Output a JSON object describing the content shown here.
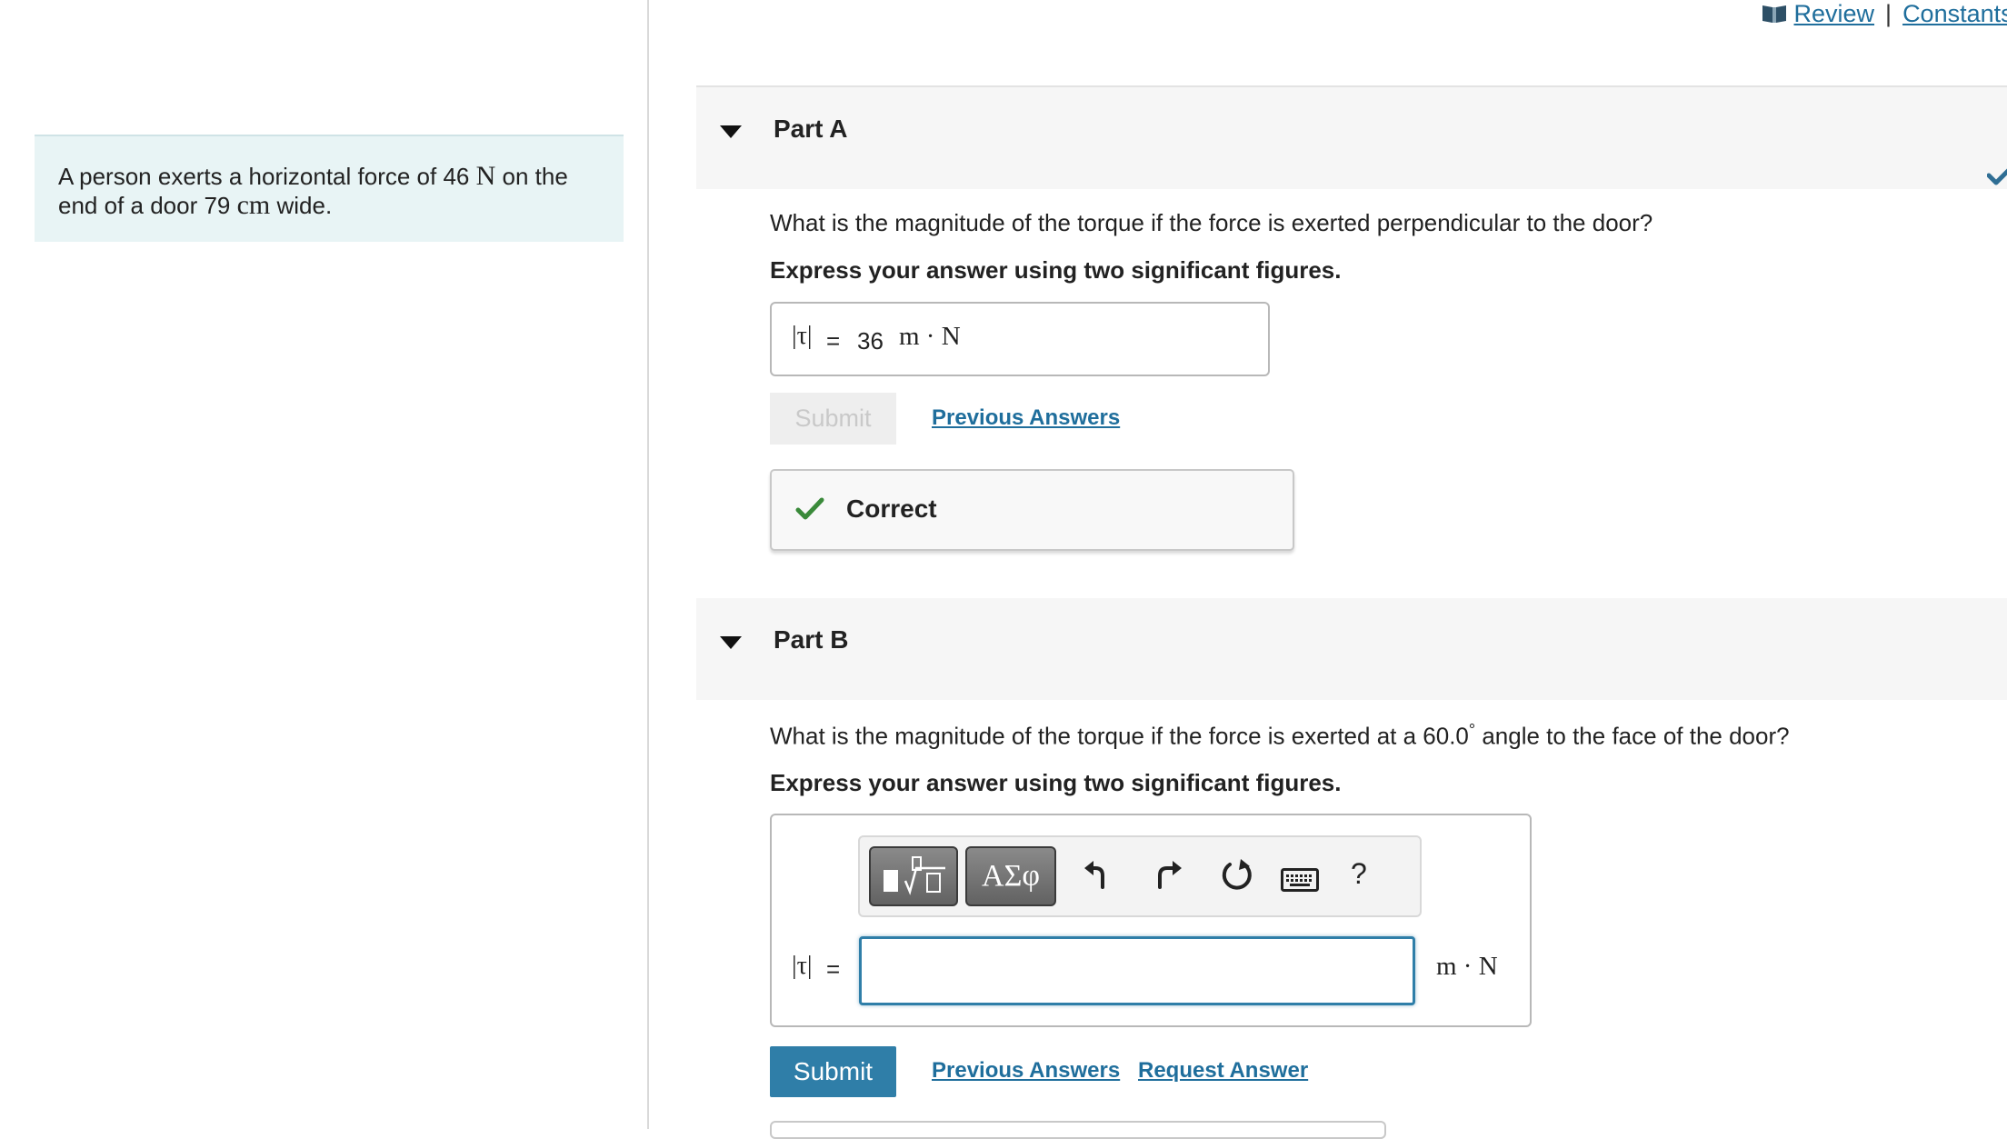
{
  "problem": {
    "text_before": "A person exerts a horizontal force of 46 ",
    "unit_force": "N",
    "text_middle": " on the end of a door 79 ",
    "unit_length": "cm",
    "text_after": " wide."
  },
  "top_links": {
    "review": "Review",
    "separator": "|",
    "constants": "Constants"
  },
  "part_a": {
    "title": "Part A",
    "question": "What is the magnitude of the torque if the force is exerted perpendicular to the door?",
    "instruction": "Express your answer using two significant figures.",
    "lhs": "|τ|",
    "equals": "=",
    "answer_value": "36",
    "unit": "m · N",
    "submit_label": "Submit",
    "previous_answers": "Previous Answers",
    "feedback": "Correct"
  },
  "part_b": {
    "title": "Part B",
    "question_before": "What is the magnitude of the torque if the force is exerted at a 60.0",
    "degree": "°",
    "question_after": " angle to the face of the door?",
    "instruction": "Express your answer using two significant figures.",
    "toolbar": {
      "symbols_label": "ΑΣφ",
      "help_label": "?"
    },
    "lhs": "|τ|",
    "equals": "=",
    "answer_value": "",
    "unit": "m · N",
    "submit_label": "Submit",
    "previous_answers": "Previous Answers",
    "request_answer": "Request Answer"
  },
  "colors": {
    "link": "#1f6e9c",
    "submit_bg": "#2f7ea8",
    "correct_check": "#3a8a3a",
    "problem_bg": "#e8f4f5"
  }
}
